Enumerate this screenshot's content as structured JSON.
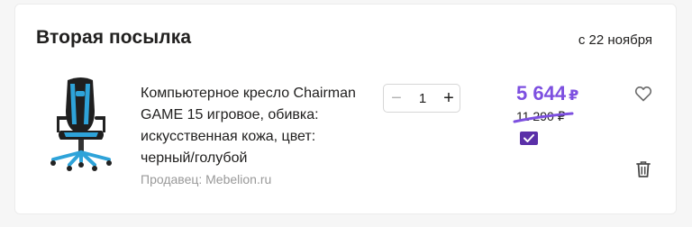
{
  "shipment": {
    "title": "Вторая посылка",
    "delivery_date": "с 22 ноября"
  },
  "item": {
    "image_icon": "office-chair-image",
    "name": "Компьютерное кресло Chairman GAME 15 игровое, обивка: искусственная кожа, цвет: черный/голубой",
    "seller": "Продавец: Mebelion.ru",
    "quantity": "1",
    "minus_label": "−",
    "plus_label": "+",
    "price": "5 644",
    "price_currency": "₽",
    "old_price": "11 290 ₽",
    "payment_badge_icon": "card-check-icon",
    "favorite_icon": "heart-icon",
    "delete_icon": "trash-icon"
  },
  "colors": {
    "accent": "#7d50e0",
    "text": "#21201f",
    "muted": "#999999"
  }
}
